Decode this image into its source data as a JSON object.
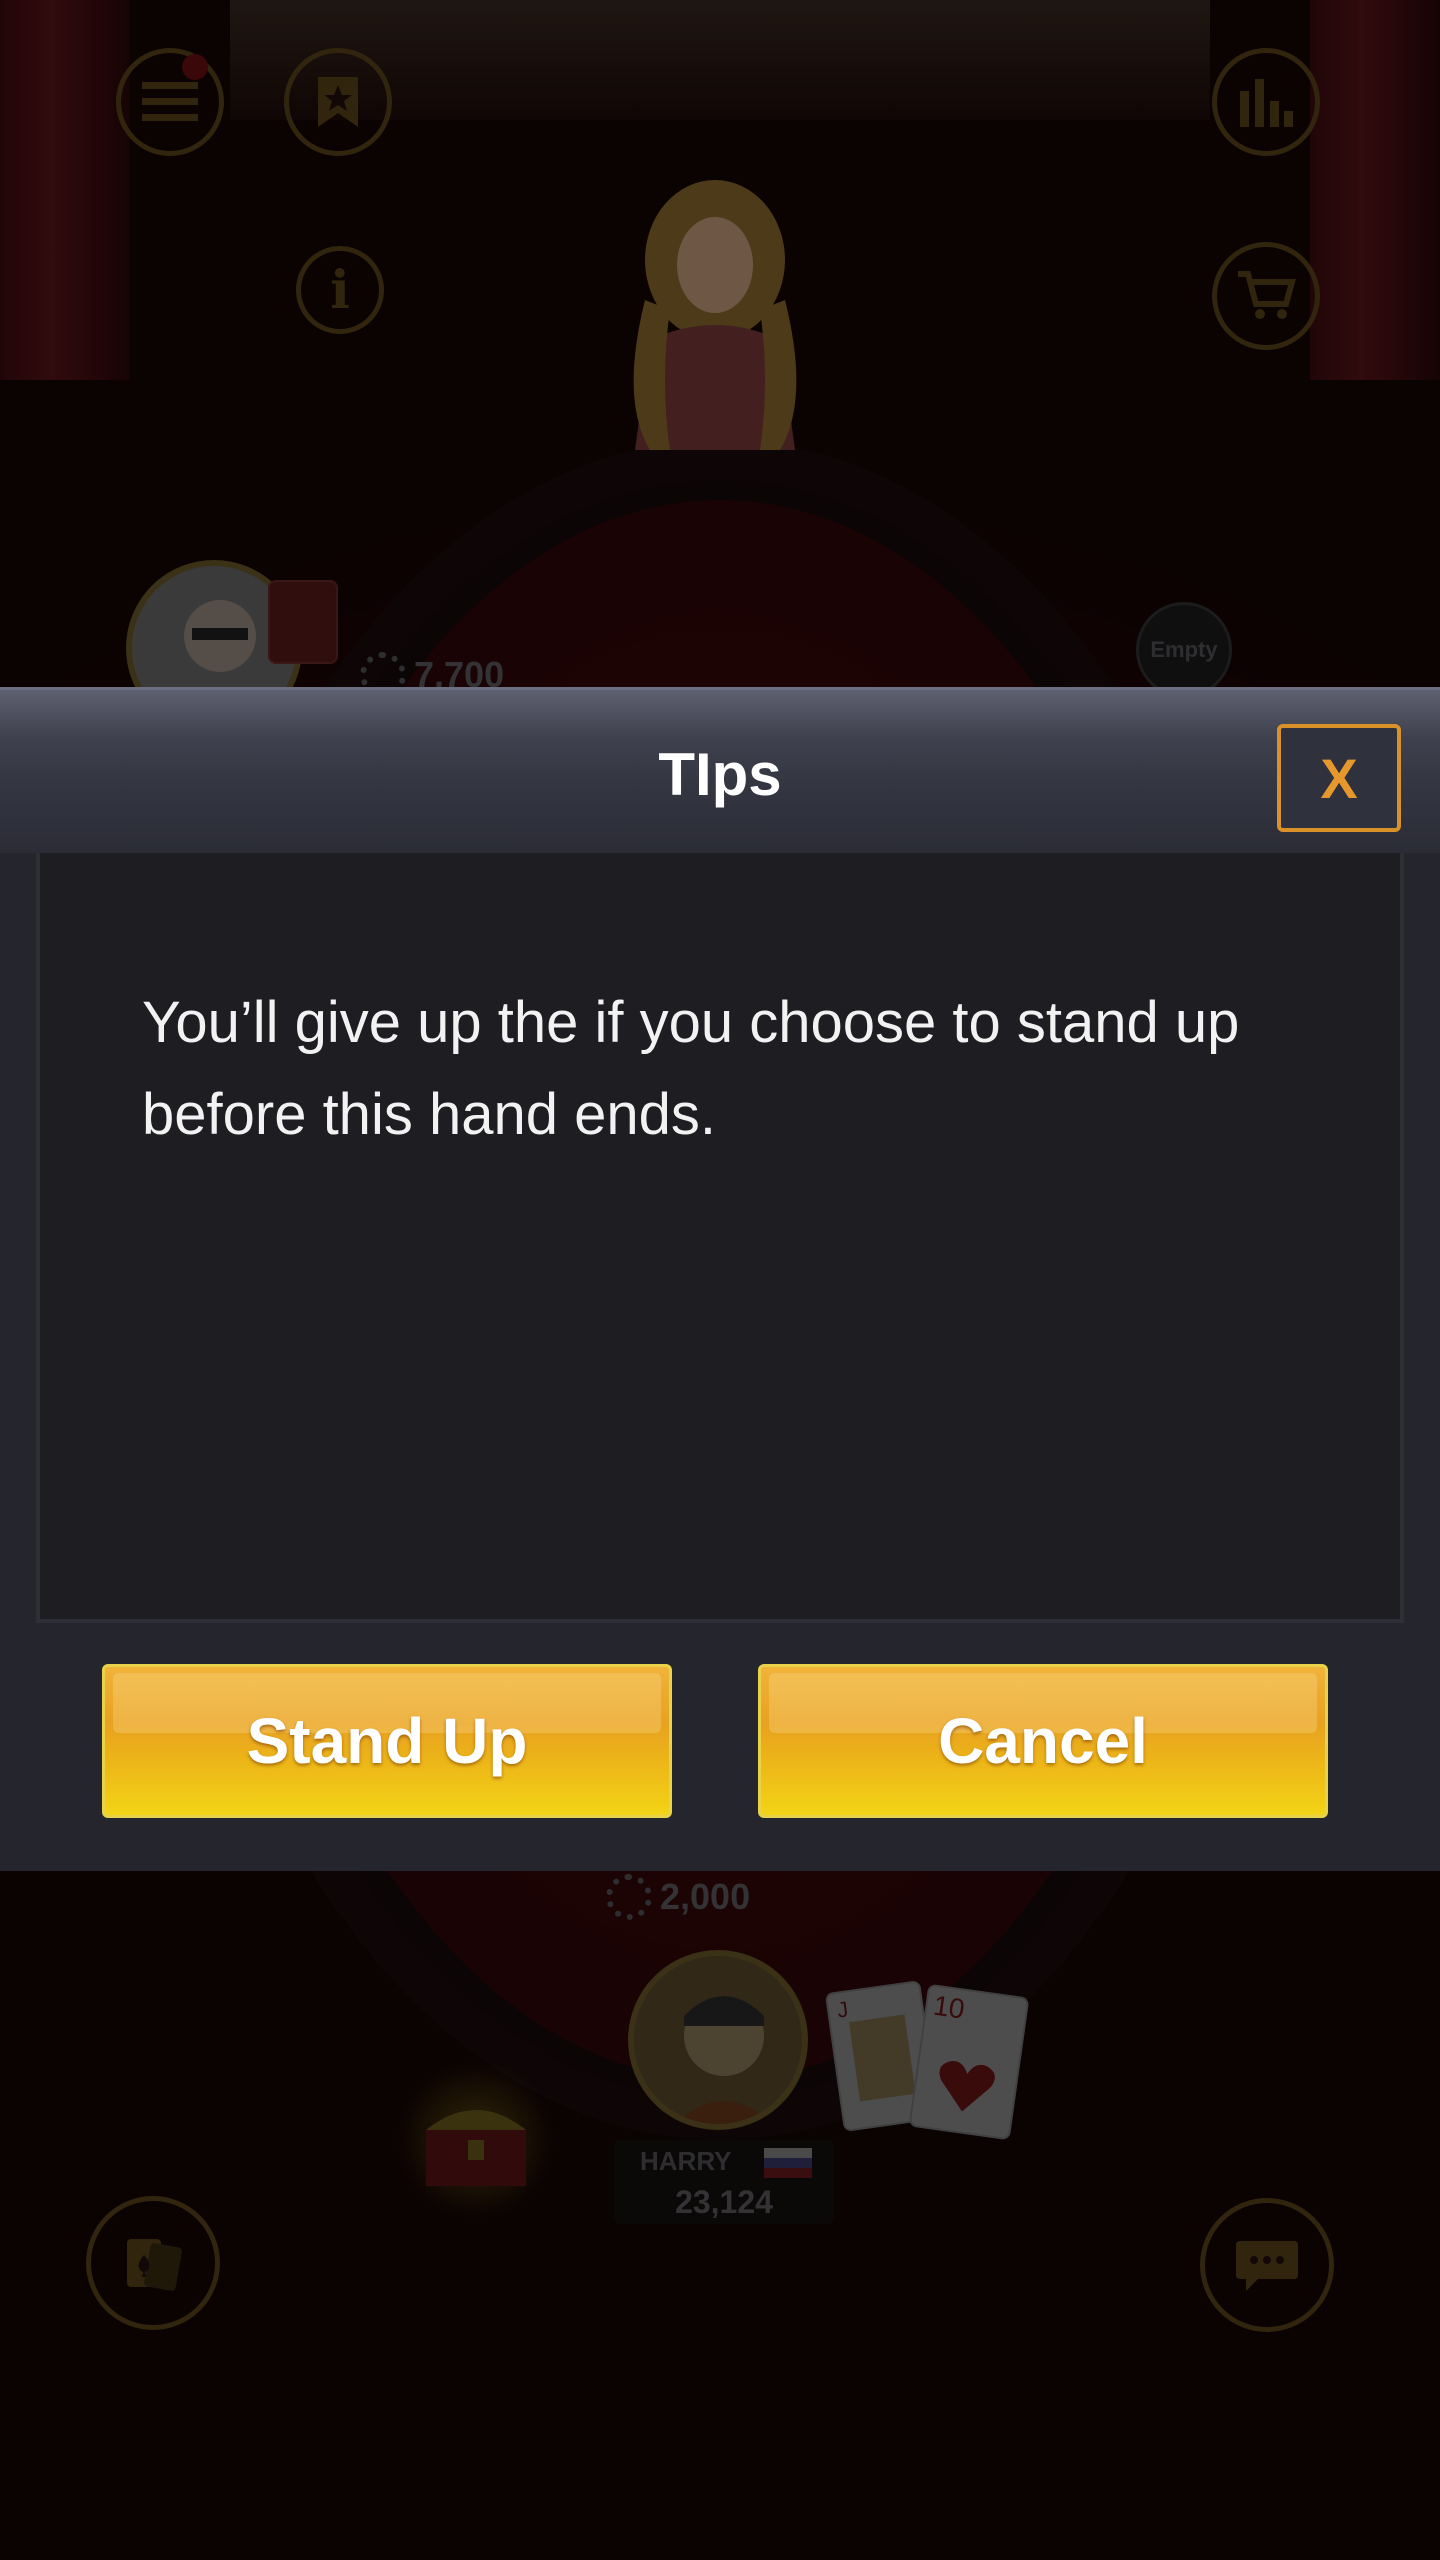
{
  "dialog": {
    "title": "TIps",
    "close_label": "X",
    "message": "You’ll give up the if you choose to stand up before this hand ends.",
    "primary_button": "Stand Up",
    "secondary_button": "Cancel"
  },
  "table": {
    "top_seat_chips": "7,700",
    "empty_seat_label": "Empty",
    "pot_chips": "2,000",
    "player": {
      "name": "HARRY",
      "chips": "23,124",
      "cards": [
        {
          "rank": "J",
          "suit": "hearts"
        },
        {
          "rank": "10",
          "suit": "hearts"
        }
      ]
    }
  },
  "icons": {
    "top_left": [
      "menu-icon",
      "bookmark-star-icon",
      "info-icon"
    ],
    "top_right": [
      "stats-icon",
      "shop-cart-icon"
    ],
    "bottom": [
      "cards-icon",
      "chat-icon",
      "treasure-chest-icon"
    ]
  },
  "colors": {
    "accent_gold": "#e8a122",
    "close_orange": "#e6982c",
    "dialog_bg": "#25262d",
    "message_panel": "#1d1d22"
  }
}
